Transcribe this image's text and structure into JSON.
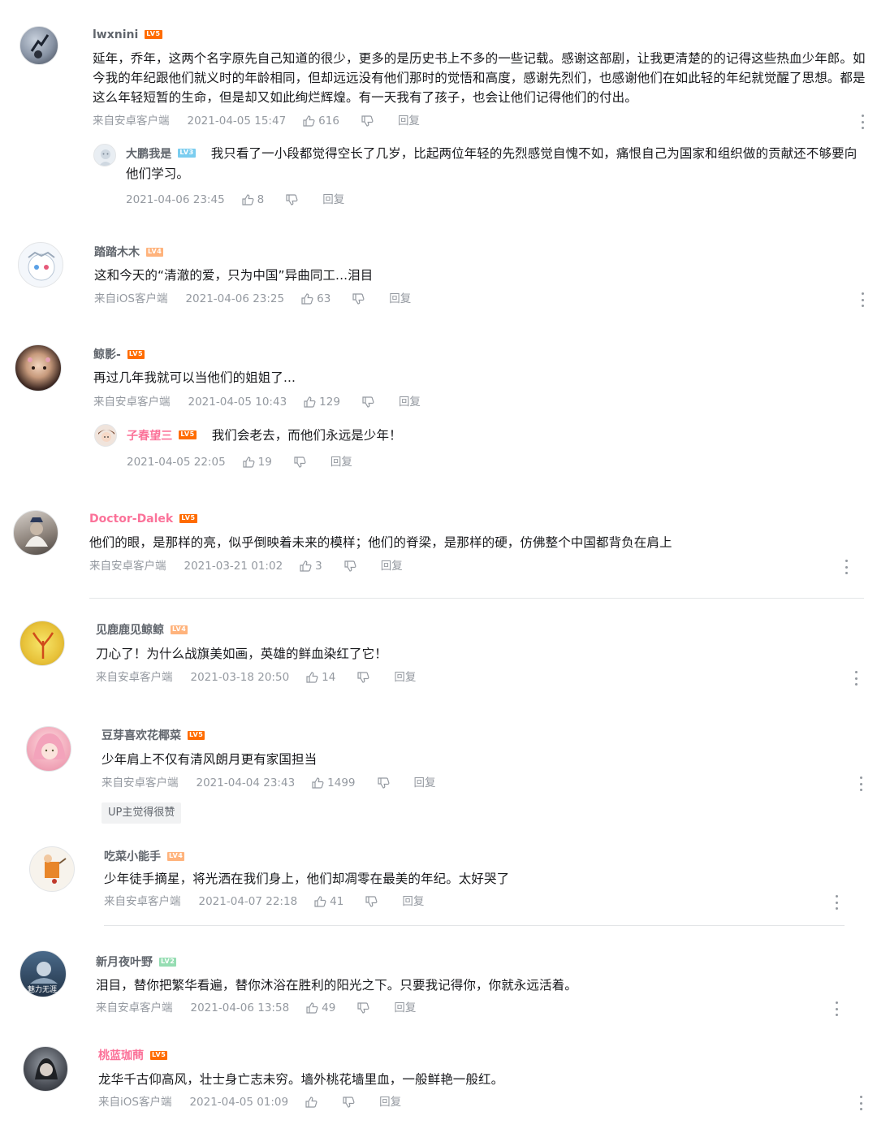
{
  "comments": [
    {
      "username": "lwxnini",
      "level": "LV5",
      "text": "延年，乔年，这两个名字原先自己知道的很少，更多的是历史书上不多的一些记载。感谢这部剧，让我更清楚的的记得这些热血少年郎。如今我的年纪跟他们就义时的年龄相同，但却远远没有他们那时的觉悟和高度，感谢先烈们，也感谢他们在如此轻的年纪就觉醒了思想。都是这么年轻短暂的生命，但是却又如此绚烂辉煌。有一天我有了孩子，也会让他们记得他们的付出。",
      "source": "来自安卓客户端",
      "time": "2021-04-05 15:47",
      "likes": "616",
      "reply_label": "回复",
      "reply": {
        "username": "大鹏我是",
        "level": "LV3",
        "text": "我只看了一小段都觉得空长了几岁，比起两位年轻的先烈感觉自愧不如，痛恨自己为国家和组织做的贡献还不够要向他们学习。",
        "time": "2021-04-06 23:45",
        "likes": "8",
        "reply_label": "回复"
      }
    },
    {
      "username": "踏踏木木",
      "level": "LV4",
      "text": "这和今天的“清澈的爱，只为中国”异曲同工...泪目",
      "source": "来自iOS客户端",
      "time": "2021-04-06 23:25",
      "likes": "63",
      "reply_label": "回复"
    },
    {
      "username": "鲸影-",
      "level": "LV5",
      "text": "再过几年我就可以当他们的姐姐了...",
      "source": "来自安卓客户端",
      "time": "2021-04-05 10:43",
      "likes": "129",
      "reply_label": "回复",
      "reply": {
        "username": "子春望三",
        "level": "LV5",
        "text": "我们会老去，而他们永远是少年！",
        "time": "2021-04-05 22:05",
        "likes": "19",
        "reply_label": "回复"
      }
    },
    {
      "username": "Doctor-Dalek",
      "level": "LV5",
      "text": "他们的眼，是那样的亮，似乎倒映着未来的模样；他们的脊梁，是那样的硬，仿佛整个中国都背负在肩上",
      "source": "来自安卓客户端",
      "time": "2021-03-21 01:02",
      "likes": "3",
      "reply_label": "回复"
    },
    {
      "username": "见鹿鹿见鲸鲸",
      "level": "LV4",
      "text": "刀心了！为什么战旗美如画，英雄的鲜血染红了它！",
      "source": "来自安卓客户端",
      "time": "2021-03-18 20:50",
      "likes": "14",
      "reply_label": "回复"
    },
    {
      "username": "豆芽喜欢花椰菜",
      "level": "LV5",
      "text": "少年肩上不仅有清风朗月更有家国担当",
      "source": "来自安卓客户端",
      "time": "2021-04-04 23:43",
      "likes": "1499",
      "reply_label": "回复",
      "up_tag": "UP主觉得很赞"
    },
    {
      "username": "吃菜小能手",
      "level": "LV4",
      "text": "少年徒手摘星，将光洒在我们身上，他们却凋零在最美的年纪。太好哭了",
      "source": "来自安卓客户端",
      "time": "2021-04-07 22:18",
      "likes": "41",
      "reply_label": "回复"
    },
    {
      "username": "新月夜叶野",
      "level": "LV2",
      "avatar_text": "魅力无涯",
      "text": "泪目，替你把繁华看遍，替你沐浴在胜利的阳光之下。只要我记得你，你就永远活着。",
      "source": "来自安卓客户端",
      "time": "2021-04-06 13:58",
      "likes": "49",
      "reply_label": "回复"
    },
    {
      "username": "桃蓝珈蔄",
      "level": "LV5",
      "text": "龙华千古仰高风，壮士身亡志未穷。墙外桃花墙里血，一般鲜艳一般红。",
      "source": "来自iOS客户端",
      "time": "2021-04-05 01:09",
      "likes": "",
      "reply_label": "回复"
    }
  ],
  "colors": {
    "meta_gray": "#9499a0",
    "name_gray": "#61666d",
    "vip_pink": "#fb7299",
    "level_orange": "#ff6c00"
  },
  "icons": {
    "like": "thumbs-up-icon",
    "dislike": "thumbs-down-icon",
    "more": "more-vertical-icon"
  }
}
